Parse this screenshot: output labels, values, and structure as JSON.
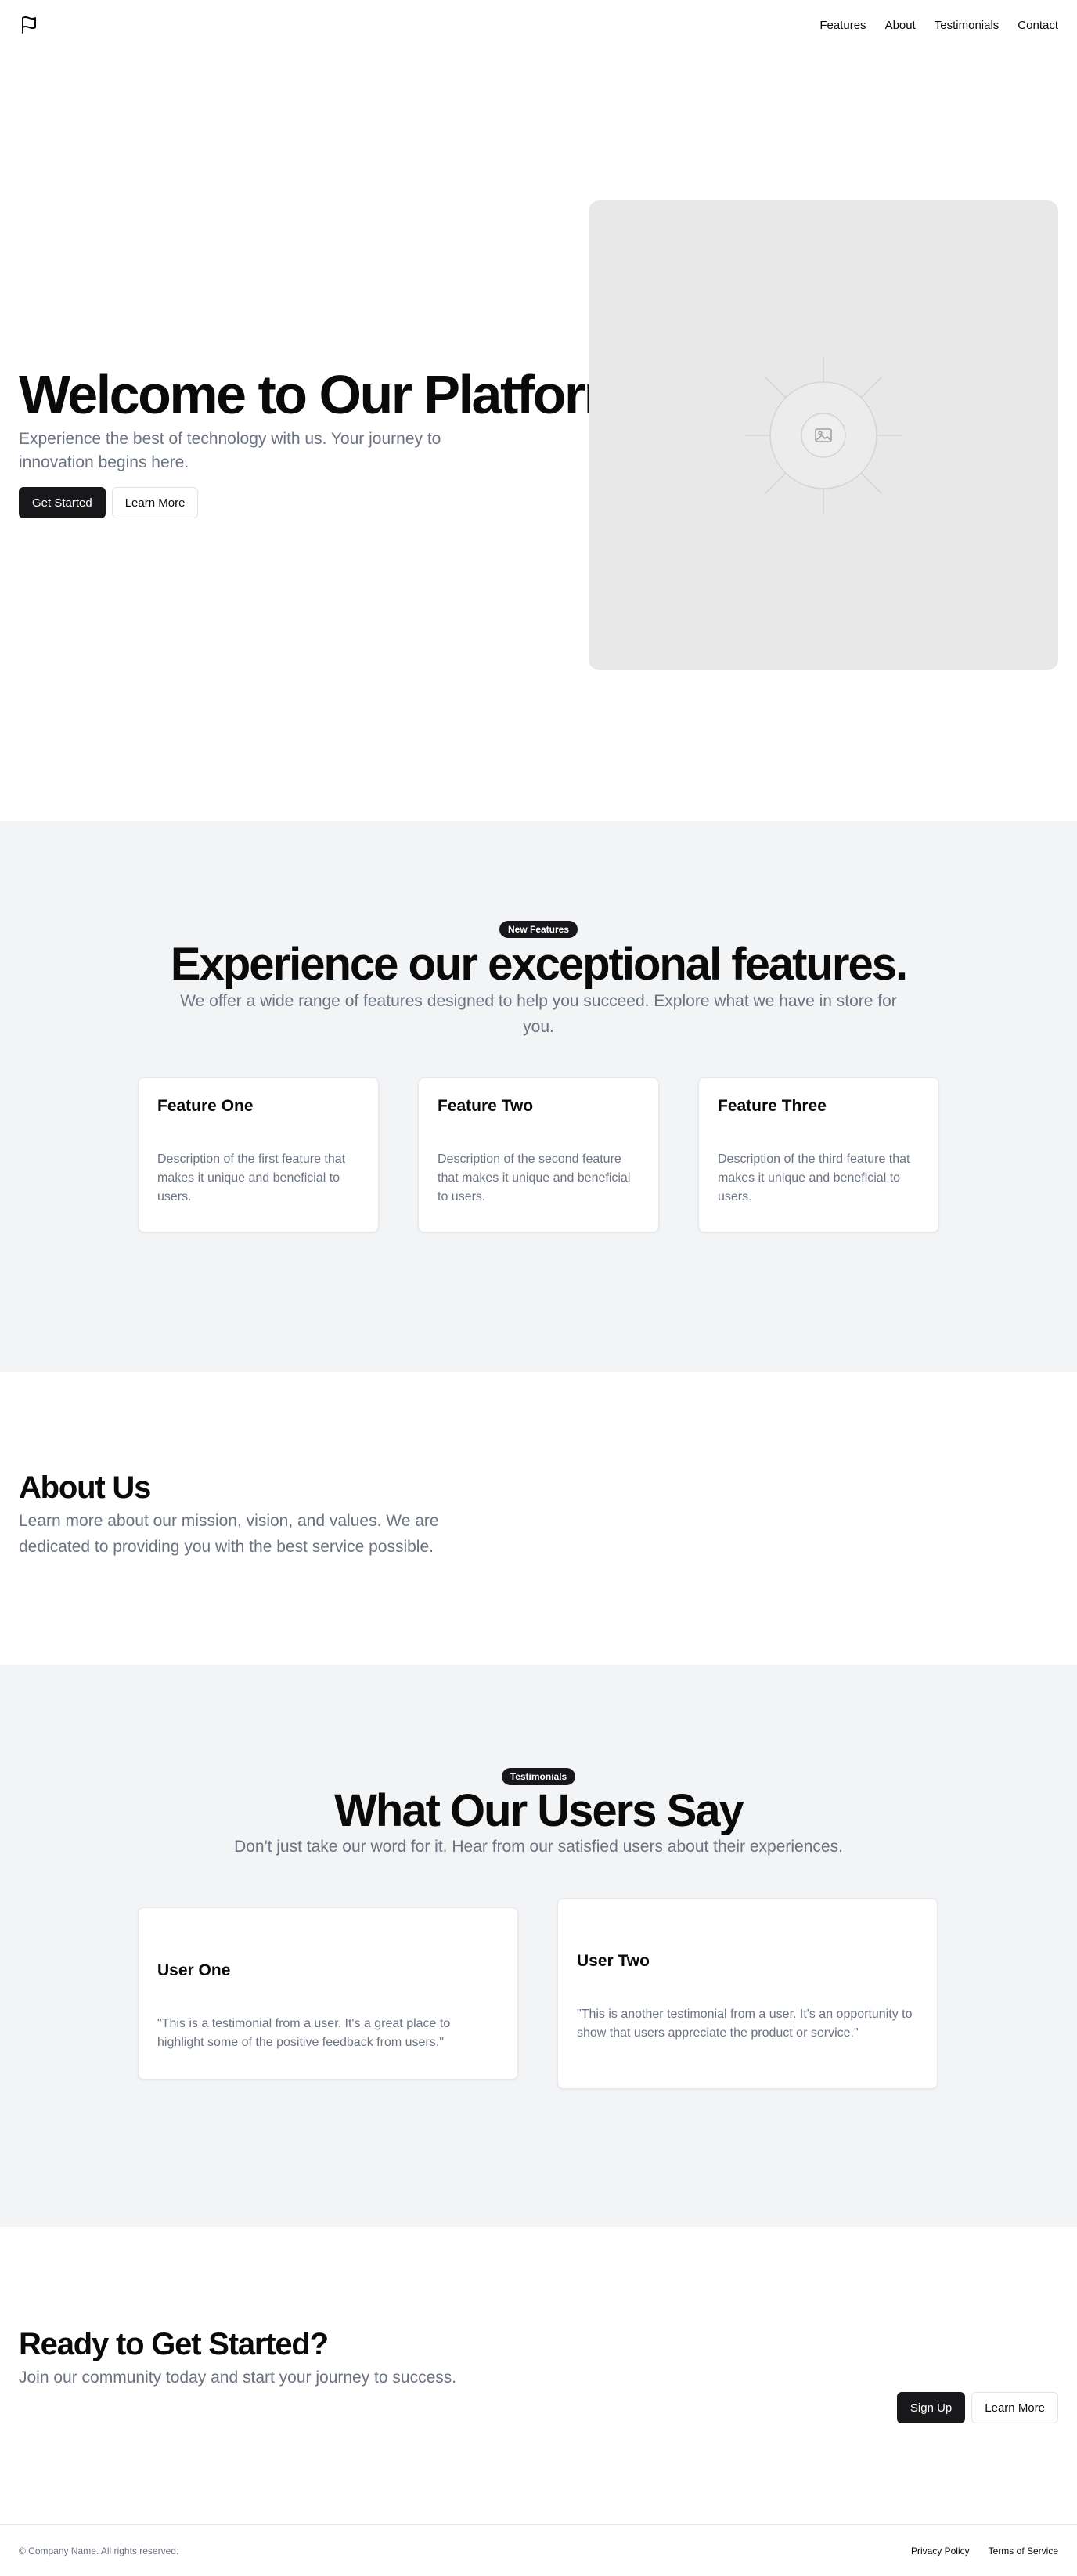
{
  "header": {
    "logo_icon": "flag-icon",
    "nav": [
      "Features",
      "About",
      "Testimonials",
      "Contact"
    ]
  },
  "hero": {
    "title": "Welcome to Our Platform",
    "subtitle": "Experience the best of technology with us. Your journey to innovation begins here.",
    "primary_button": "Get Started",
    "secondary_button": "Learn More",
    "image_icon": "image-placeholder-icon"
  },
  "features": {
    "badge": "New Features",
    "title": "Experience our exceptional features.",
    "subtitle": "We offer a wide range of features designed to help you succeed. Explore what we have in store for you.",
    "cards": [
      {
        "title": "Feature One",
        "description": "Description of the first feature that makes it unique and beneficial to users."
      },
      {
        "title": "Feature Two",
        "description": "Description of the second feature that makes it unique and beneficial to users."
      },
      {
        "title": "Feature Three",
        "description": "Description of the third feature that makes it unique and beneficial to users."
      }
    ]
  },
  "about": {
    "title": "About Us",
    "subtitle": "Learn more about our mission, vision, and values. We are dedicated to providing you with the best service possible."
  },
  "testimonials": {
    "badge": "Testimonials",
    "title": "What Our Users Say",
    "subtitle": "Don't just take our word for it. Hear from our satisfied users about their experiences.",
    "items": [
      {
        "name": "User One",
        "quote": "\"This is a testimonial from a user. It's a great place to highlight some of the positive feedback from users.\""
      },
      {
        "name": "User Two",
        "quote": "\"This is another testimonial from a user. It's an opportunity to show that users appreciate the product or service.\""
      }
    ]
  },
  "cta": {
    "title": "Ready to Get Started?",
    "subtitle": "Join our community today and start your journey to success.",
    "primary_button": "Sign Up",
    "secondary_button": "Learn More"
  },
  "footer": {
    "copyright": "© Company Name. All rights reserved.",
    "links": [
      "Privacy Policy",
      "Terms of Service"
    ]
  },
  "colors": {
    "primary": "#18181b",
    "muted_text": "#6b7280",
    "section_bg": "#f3f4f6",
    "image_bg": "#e8e8e8"
  }
}
